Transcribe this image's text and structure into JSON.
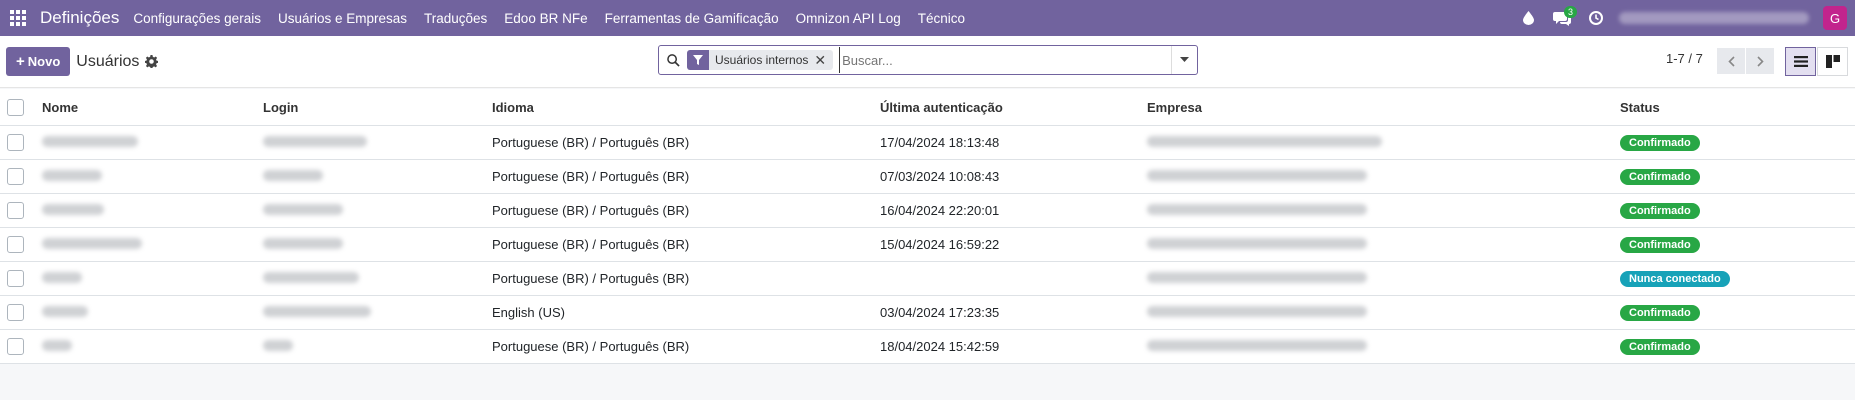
{
  "navbar": {
    "brand": "Definições",
    "menu": [
      "Configurações gerais",
      "Usuários e Empresas",
      "Traduções",
      "Edoo BR NFe",
      "Ferramentas de Gamificação",
      "Omnizon API Log",
      "Técnico"
    ],
    "chat_count": "3",
    "avatar_letter": "G"
  },
  "control": {
    "new_label": "Novo",
    "breadcrumb": "Usuários",
    "facet_label": "Usuários internos",
    "search_placeholder": "Buscar...",
    "pager": "1-7 / 7"
  },
  "table": {
    "headers": {
      "name": "Nome",
      "login": "Login",
      "language": "Idioma",
      "last_auth": "Última autenticação",
      "company": "Empresa",
      "status": "Status"
    },
    "rows": [
      {
        "language": "Portuguese (BR) / Português (BR)",
        "last_auth": "17/04/2024 18:13:48",
        "status": "Confirmado",
        "status_color": "#28a745"
      },
      {
        "language": "Portuguese (BR) / Português (BR)",
        "last_auth": "07/03/2024 10:08:43",
        "status": "Confirmado",
        "status_color": "#28a745"
      },
      {
        "language": "Portuguese (BR) / Português (BR)",
        "last_auth": "16/04/2024 22:20:01",
        "status": "Confirmado",
        "status_color": "#28a745"
      },
      {
        "language": "Portuguese (BR) / Português (BR)",
        "last_auth": "15/04/2024 16:59:22",
        "status": "Confirmado",
        "status_color": "#28a745"
      },
      {
        "language": "Portuguese (BR) / Português (BR)",
        "last_auth": "",
        "status": "Nunca conectado",
        "status_color": "#17a2b8"
      },
      {
        "language": "English (US)",
        "last_auth": "03/04/2024 17:23:35",
        "status": "Confirmado",
        "status_color": "#28a745"
      },
      {
        "language": "Portuguese (BR) / Português (BR)",
        "last_auth": "18/04/2024 15:42:59",
        "status": "Confirmado",
        "status_color": "#28a745"
      }
    ]
  },
  "colors": {
    "brand": "#71639e",
    "confirmed": "#28a745",
    "never": "#17a2b8"
  }
}
